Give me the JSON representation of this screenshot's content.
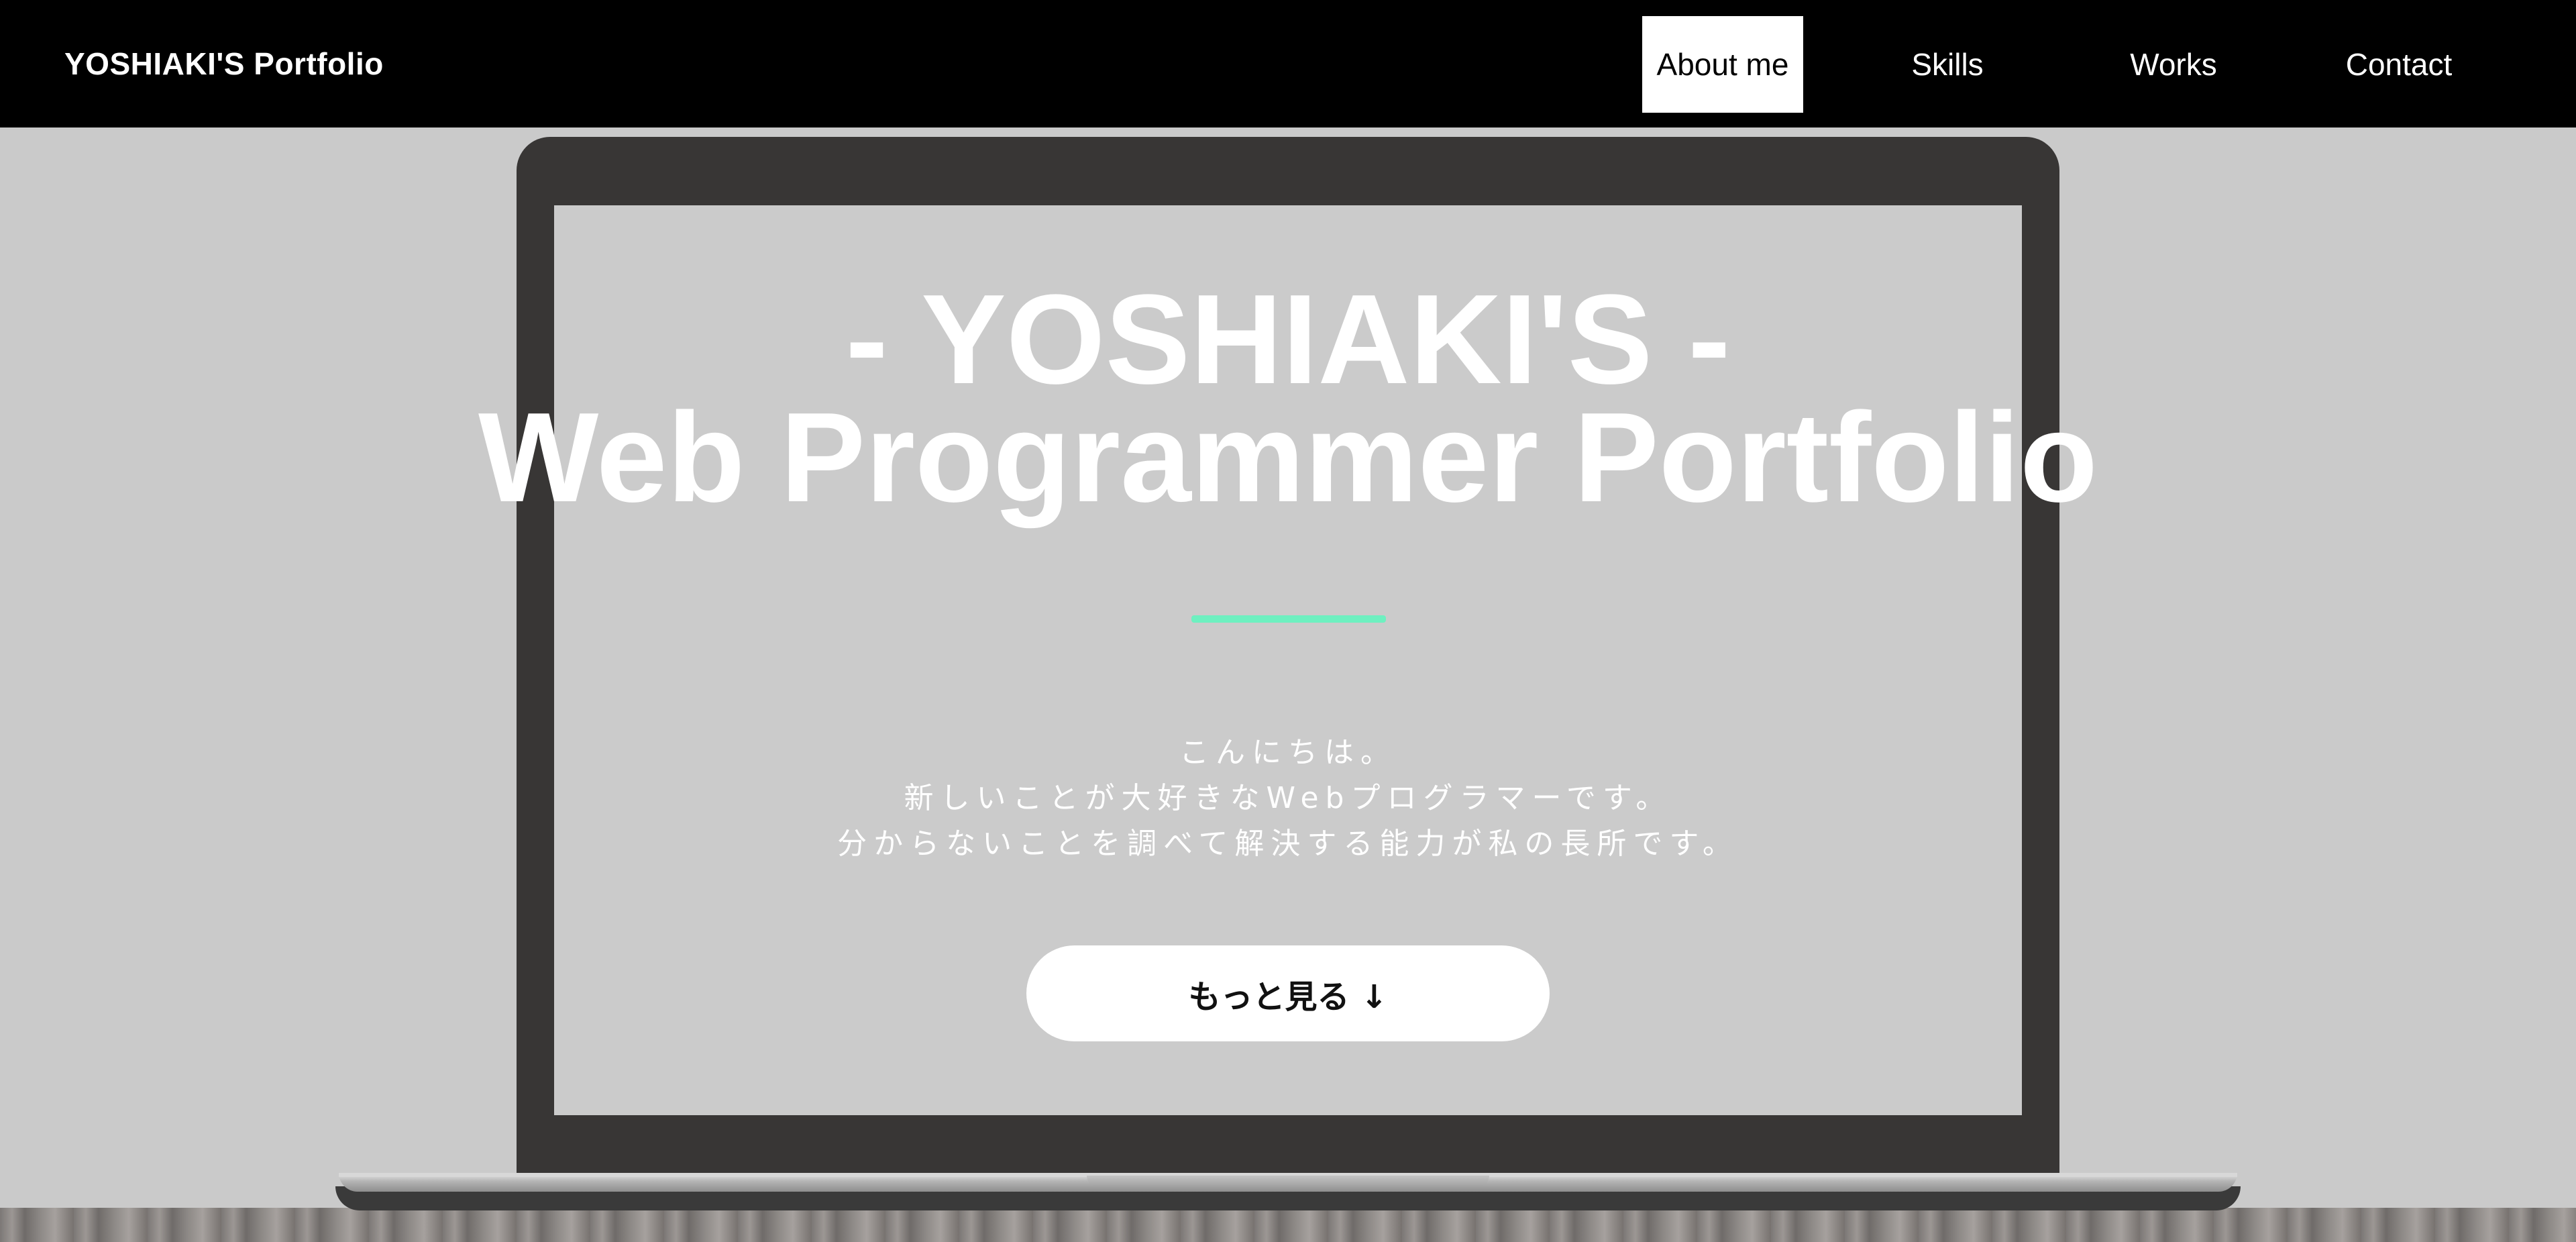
{
  "header": {
    "brand": "YOSHIAKI'S Portfolio",
    "nav": [
      {
        "label": "About me",
        "active": true
      },
      {
        "label": "Skills",
        "active": false
      },
      {
        "label": "Works",
        "active": false
      },
      {
        "label": "Contact",
        "active": false
      }
    ]
  },
  "hero": {
    "title_line_1": "- YOSHIAKI'S -",
    "title_line_2": "Web Programmer Portfolio",
    "intro_lines": [
      "こんにちは。",
      "新しいことが大好きなWebプログラマーです。",
      "分からないことを調べて解決する能力が私の長所です。"
    ],
    "more_button_label": "もっと見る ↓"
  },
  "colors": {
    "header_bg": "#000000",
    "page_bg": "#cacaca",
    "accent": "#6ef0c0",
    "laptop_frame": "#383635"
  }
}
